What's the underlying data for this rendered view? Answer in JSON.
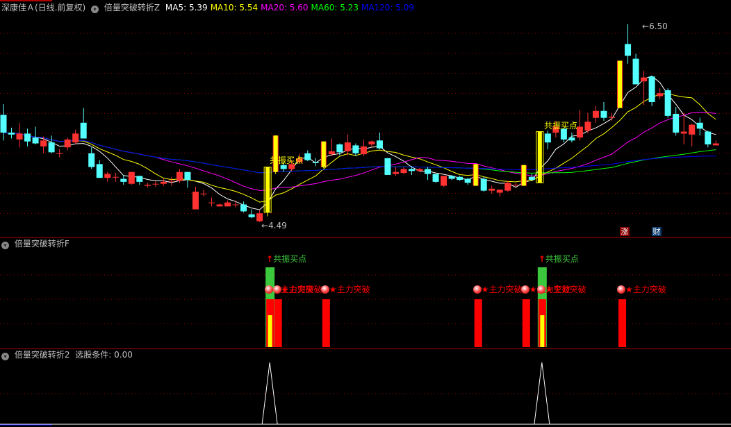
{
  "main": {
    "stock": "深康佳Ａ",
    "period": "(日线.前复权)",
    "indicator": "倍量突破转折Z",
    "ma": [
      {
        "label": "MA5:",
        "value": "5.39",
        "color": "#ffffff"
      },
      {
        "label": "MA10:",
        "value": "5.54",
        "color": "#ffff00"
      },
      {
        "label": "MA20:",
        "value": "5.60",
        "color": "#ff00ff"
      },
      {
        "label": "MA60:",
        "value": "5.23",
        "color": "#00ff00"
      },
      {
        "label": "MA120:",
        "value": "5.09",
        "color": "#0000ff"
      }
    ],
    "max_label": "6.50",
    "min_label": "4.49",
    "signal_text": "共振买点",
    "badge_zhang": "涨",
    "badge_cai": "财"
  },
  "panel2": {
    "title": "倍量突破转折F",
    "buy_text": "共振买点",
    "break_text": "主力突破"
  },
  "panel3": {
    "title": "倍量突破转折2",
    "cond_label": "选股条件:",
    "cond_value": "0.00"
  },
  "colors": {
    "up": "#ff3232",
    "down": "#54ffff",
    "signal": "#ffff00",
    "grid": "#a00000",
    "buy": "#3cc83c"
  },
  "chart_data": {
    "type": "candlestick",
    "price_range": [
      4.49,
      6.5
    ],
    "candles": [
      [
        5.58,
        5.69,
        5.32,
        5.4
      ],
      [
        5.4,
        5.45,
        5.34,
        5.38
      ],
      [
        5.33,
        5.5,
        5.25,
        5.39
      ],
      [
        5.39,
        5.44,
        5.26,
        5.31
      ],
      [
        5.35,
        5.46,
        5.28,
        5.29
      ],
      [
        5.26,
        5.36,
        5.19,
        5.32
      ],
      [
        5.3,
        5.37,
        5.19,
        5.2
      ],
      [
        5.19,
        5.23,
        5.15,
        5.19
      ],
      [
        5.25,
        5.35,
        5.22,
        5.33
      ],
      [
        5.3,
        5.43,
        5.28,
        5.39
      ],
      [
        5.5,
        5.65,
        5.34,
        5.34
      ],
      [
        5.19,
        5.25,
        5.03,
        5.05
      ],
      [
        5.08,
        5.12,
        4.94,
        4.94
      ],
      [
        4.94,
        5.0,
        4.9,
        4.98
      ],
      [
        4.95,
        4.99,
        4.9,
        4.95
      ],
      [
        4.93,
        4.97,
        4.87,
        4.9
      ],
      [
        4.88,
        5.0,
        4.87,
        5.0
      ],
      [
        4.96,
        4.96,
        4.87,
        4.9
      ],
      [
        4.86,
        4.89,
        4.84,
        4.87
      ],
      [
        4.88,
        4.91,
        4.85,
        4.88
      ],
      [
        4.88,
        4.93,
        4.86,
        4.9
      ],
      [
        4.91,
        4.95,
        4.86,
        4.91
      ],
      [
        4.91,
        5.03,
        4.89,
        5.0
      ],
      [
        5.0,
        5.0,
        4.84,
        4.92
      ],
      [
        4.62,
        4.85,
        4.62,
        4.8
      ],
      [
        4.78,
        4.82,
        4.75,
        4.78
      ],
      [
        4.69,
        4.74,
        4.65,
        4.69
      ],
      [
        4.65,
        4.68,
        4.65,
        4.67
      ],
      [
        4.65,
        4.71,
        4.65,
        4.69
      ],
      [
        4.67,
        4.71,
        4.64,
        4.67
      ],
      [
        4.67,
        4.7,
        4.59,
        4.6
      ],
      [
        4.57,
        4.62,
        4.53,
        4.54
      ],
      [
        4.5,
        4.61,
        4.49,
        4.58
      ],
      [
        4.59,
        5.05,
        4.55,
        5.05
      ],
      [
        5.0,
        5.37,
        4.98,
        5.37
      ],
      [
        5.07,
        5.1,
        5.0,
        5.03
      ],
      [
        5.03,
        5.12,
        5.01,
        5.08
      ],
      [
        5.1,
        5.18,
        5.09,
        5.14
      ],
      [
        5.19,
        5.22,
        5.11,
        5.12
      ],
      [
        5.1,
        5.14,
        5.06,
        5.09
      ],
      [
        5.05,
        5.31,
        5.04,
        5.31
      ],
      [
        5.18,
        5.34,
        5.16,
        5.21
      ],
      [
        5.28,
        5.29,
        5.17,
        5.2
      ],
      [
        5.21,
        5.38,
        5.17,
        5.3
      ],
      [
        5.27,
        5.29,
        5.16,
        5.19
      ],
      [
        5.18,
        5.33,
        5.16,
        5.26
      ],
      [
        5.28,
        5.32,
        5.25,
        5.31
      ],
      [
        5.32,
        5.4,
        5.23,
        5.24
      ],
      [
        5.14,
        5.14,
        4.97,
        4.97
      ],
      [
        4.98,
        5.05,
        4.96,
        5.0
      ],
      [
        4.99,
        5.05,
        4.98,
        5.03
      ],
      [
        5.03,
        5.06,
        4.97,
        5.01
      ],
      [
        5.01,
        5.04,
        5.0,
        5.03
      ],
      [
        5.03,
        5.05,
        4.92,
        4.98
      ],
      [
        4.98,
        4.98,
        4.89,
        4.9
      ],
      [
        4.86,
        4.96,
        4.85,
        4.96
      ],
      [
        4.96,
        4.97,
        4.92,
        4.93
      ],
      [
        4.95,
        4.96,
        4.91,
        4.92
      ],
      [
        4.93,
        4.94,
        4.87,
        4.89
      ],
      [
        4.86,
        5.08,
        4.86,
        5.08
      ],
      [
        4.93,
        4.95,
        4.8,
        4.81
      ],
      [
        4.81,
        4.86,
        4.78,
        4.83
      ],
      [
        4.79,
        4.82,
        4.75,
        4.82
      ],
      [
        4.81,
        4.91,
        4.8,
        4.89
      ],
      [
        4.87,
        4.89,
        4.85,
        4.87
      ],
      [
        4.86,
        5.07,
        4.86,
        5.07
      ],
      [
        4.95,
        4.98,
        4.91,
        4.92
      ],
      [
        4.89,
        5.41,
        4.89,
        5.41
      ],
      [
        5.39,
        5.42,
        5.23,
        5.3
      ],
      [
        5.4,
        5.52,
        5.35,
        5.46
      ],
      [
        5.44,
        5.44,
        5.3,
        5.33
      ],
      [
        5.35,
        5.4,
        5.3,
        5.32
      ],
      [
        5.35,
        5.63,
        5.32,
        5.46
      ],
      [
        5.42,
        5.6,
        5.4,
        5.51
      ],
      [
        5.55,
        5.67,
        5.5,
        5.62
      ],
      [
        5.62,
        5.71,
        5.52,
        5.55
      ],
      [
        5.55,
        5.6,
        5.52,
        5.56
      ],
      [
        5.65,
        6.13,
        5.65,
        6.13
      ],
      [
        6.3,
        6.5,
        6.1,
        6.18
      ],
      [
        6.15,
        6.2,
        5.89,
        5.89
      ],
      [
        5.92,
        6.03,
        5.68,
        5.96
      ],
      [
        5.97,
        5.98,
        5.67,
        5.71
      ],
      [
        5.77,
        5.85,
        5.74,
        5.8
      ],
      [
        5.83,
        5.85,
        5.55,
        5.57
      ],
      [
        5.59,
        5.66,
        5.37,
        5.4
      ],
      [
        5.39,
        5.6,
        5.28,
        5.41
      ],
      [
        5.38,
        5.49,
        5.26,
        5.48
      ],
      [
        5.5,
        5.55,
        5.37,
        5.44
      ],
      [
        5.41,
        5.42,
        5.25,
        5.28
      ],
      [
        5.27,
        5.32,
        5.27,
        5.29
      ]
    ],
    "signal_candles": [
      33,
      34,
      40,
      59,
      65,
      67,
      77
    ],
    "resonance_buy": [
      33,
      67
    ],
    "main_force_breakout": [
      33,
      34,
      40,
      59,
      65,
      67,
      77
    ],
    "selection_spikes": [
      33,
      67
    ],
    "ma_periods": [
      5,
      10,
      20,
      60,
      120
    ]
  }
}
